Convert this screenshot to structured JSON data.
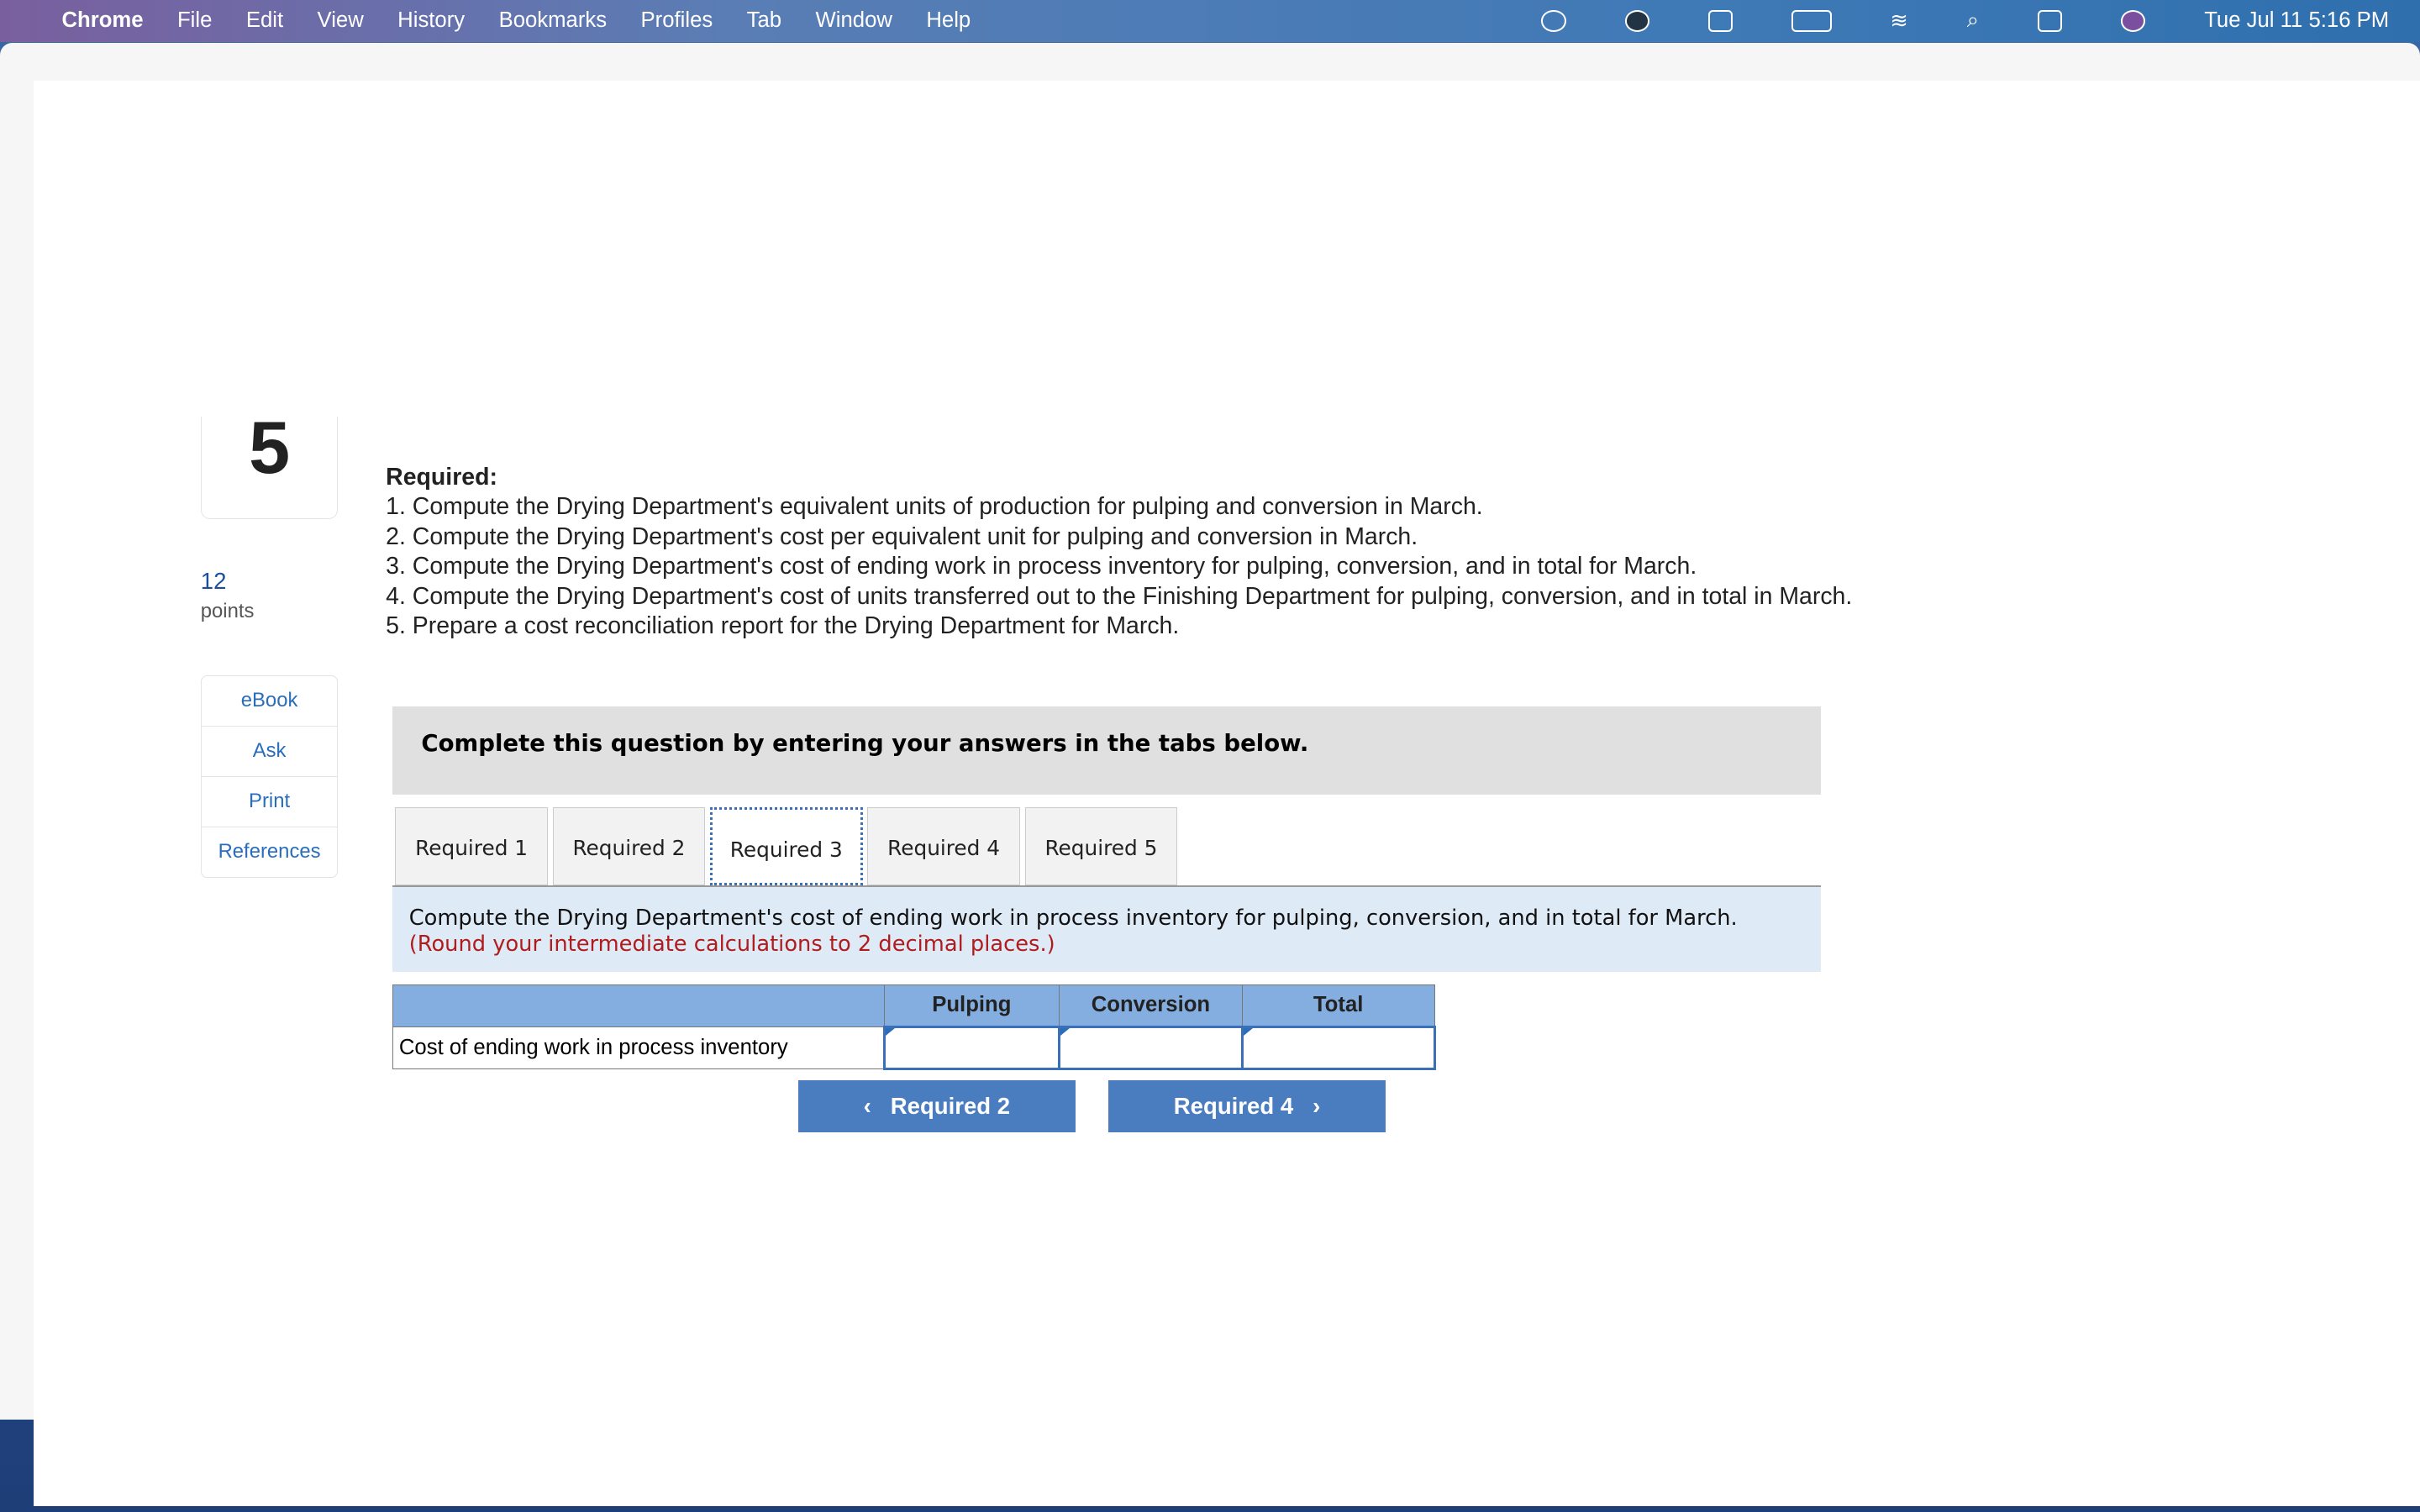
{
  "menubar": {
    "app": "Chrome",
    "items": [
      "File",
      "Edit",
      "View",
      "History",
      "Bookmarks",
      "Profiles",
      "Tab",
      "Window",
      "Help"
    ],
    "datetime": "Tue Jul 11  5:16 PM"
  },
  "question": {
    "number": "5",
    "points_value": "12",
    "points_label": "points"
  },
  "sidebar": {
    "items": [
      "eBook",
      "Ask",
      "Print",
      "References"
    ]
  },
  "required": {
    "heading": "Required:",
    "items": [
      "1. Compute the Drying Department's equivalent units of production for pulping and conversion in March.",
      "2. Compute the Drying Department's cost per equivalent unit for pulping and conversion in March.",
      "3. Compute the Drying Department's cost of ending work in process inventory for pulping, conversion, and in total for March.",
      "4. Compute the Drying Department's cost of units transferred out to the Finishing Department for pulping, conversion, and in total in March.",
      "5. Prepare a cost reconciliation report for the Drying Department for March."
    ]
  },
  "banner": "Complete this question by entering your answers in the tabs below.",
  "tabs": [
    {
      "label": "Required 1"
    },
    {
      "label": "Required 2"
    },
    {
      "label": "Required 3",
      "active": true
    },
    {
      "label": "Required 4"
    },
    {
      "label": "Required 5"
    }
  ],
  "instructions": {
    "text": "Compute the Drying Department's cost of ending work in process inventory for pulping, conversion, and in total for March.",
    "note": "(Round your intermediate calculations to 2 decimal places.)"
  },
  "table": {
    "headers": [
      "",
      "Pulping",
      "Conversion",
      "Total"
    ],
    "row_label": "Cost of ending work in process inventory",
    "values": [
      "",
      "",
      ""
    ]
  },
  "nav": {
    "prev": "Required 2",
    "next": "Required 4"
  },
  "colors": {
    "accent": "#4a7cc0",
    "header": "#84aee0",
    "note": "#b01c1c"
  }
}
